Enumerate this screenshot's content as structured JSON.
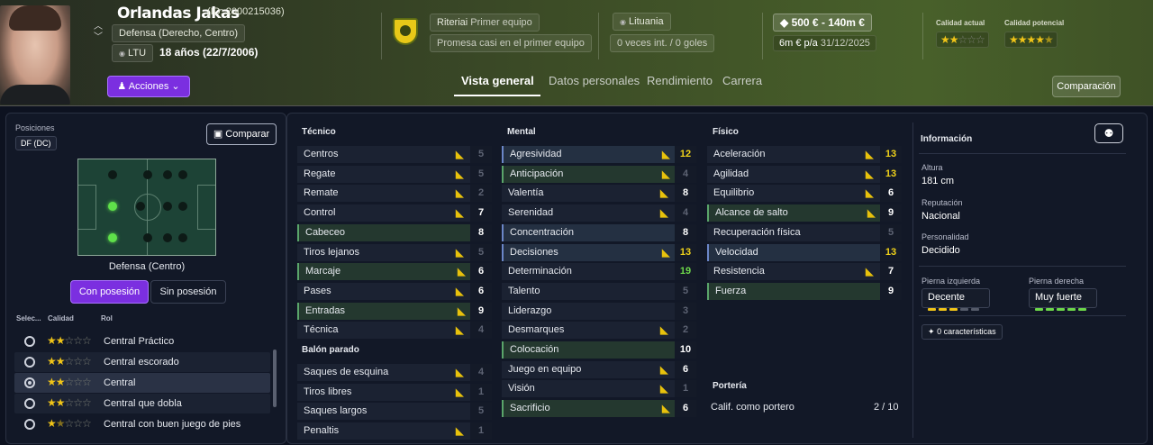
{
  "header": {
    "name": "Orlandas Jakas",
    "id": "(ID: 2000215036)",
    "position": "Defensa (Derecho, Centro)",
    "nationality_code": "LTU",
    "age": "18 años (22/7/2006)",
    "actions_label": "Acciones",
    "club": {
      "name": "Riteriai",
      "squad": "Primer equipo",
      "status": "Promesa casi en el primer equipo"
    },
    "country": {
      "name": "Lituania",
      "caps": "0 veces int. / 0 goles"
    },
    "value": "500 € - 140m €",
    "wage": "6m € p/a",
    "contract_end": "31/12/2025",
    "current_ability_label": "Calidad actual",
    "potential_ability_label": "Calidad potencial",
    "current_stars": 2,
    "potential_stars": 4.5,
    "compare_label": "Comparación",
    "tabs": [
      "Vista general",
      "Datos personales",
      "Rendimiento",
      "Carrera"
    ]
  },
  "left": {
    "positions_label": "Posiciones",
    "position_code": "DF (DC)",
    "compare_button": "Comparar",
    "position_caption": "Defensa (Centro)",
    "toggle_on": "Con posesión",
    "toggle_off": "Sin posesión",
    "col_select": "Selec...",
    "col_quality": "Calidad",
    "col_role": "Rol",
    "roles": [
      {
        "name": "Central Práctico",
        "stars": 2,
        "selected": false
      },
      {
        "name": "Central escorado",
        "stars": 2,
        "selected": false
      },
      {
        "name": "Central",
        "stars": 2,
        "selected": true
      },
      {
        "name": "Central que dobla",
        "stars": 2,
        "selected": false
      },
      {
        "name": "Central con buen juego de pies",
        "stars": 1.5,
        "selected": false
      }
    ]
  },
  "attributes": {
    "tecnico_label": "Técnico",
    "tecnico": [
      {
        "name": "Centros",
        "value": "5",
        "dim": true,
        "icon": true
      },
      {
        "name": "Regate",
        "value": "5",
        "dim": true,
        "icon": true
      },
      {
        "name": "Remate",
        "value": "2",
        "dim": true,
        "icon": true
      },
      {
        "name": "Control",
        "value": "7",
        "icon": true
      },
      {
        "name": "Cabeceo",
        "value": "8",
        "hl": "green"
      },
      {
        "name": "Tiros lejanos",
        "value": "5",
        "dim": true,
        "icon": true
      },
      {
        "name": "Marcaje",
        "value": "6",
        "hl": "green",
        "icon": true
      },
      {
        "name": "Pases",
        "value": "6",
        "icon": true
      },
      {
        "name": "Entradas",
        "value": "9",
        "hl": "green",
        "icon": true
      },
      {
        "name": "Técnica",
        "value": "4",
        "dim": true,
        "icon": true
      }
    ],
    "balon_label": "Balón parado",
    "balon": [
      {
        "name": "Saques de esquina",
        "value": "4",
        "dim": true,
        "icon": true
      },
      {
        "name": "Tiros libres",
        "value": "1",
        "dim": true,
        "icon": true
      },
      {
        "name": "Saques largos",
        "value": "5",
        "dim": true
      },
      {
        "name": "Penaltis",
        "value": "1",
        "dim": true,
        "icon": true
      }
    ],
    "mental_label": "Mental",
    "mental": [
      {
        "name": "Agresividad",
        "value": "12",
        "color": "y",
        "hl": "blue",
        "icon": true
      },
      {
        "name": "Anticipación",
        "value": "4",
        "dim": true,
        "hl": "green",
        "icon": true
      },
      {
        "name": "Valentía",
        "value": "8",
        "icon": true
      },
      {
        "name": "Serenidad",
        "value": "4",
        "dim": true,
        "icon": true
      },
      {
        "name": "Concentración",
        "value": "8",
        "hl": "blue"
      },
      {
        "name": "Decisiones",
        "value": "13",
        "color": "y",
        "hl": "blue",
        "icon": true
      },
      {
        "name": "Determinación",
        "value": "19",
        "color": "g"
      },
      {
        "name": "Talento",
        "value": "5",
        "dim": true
      },
      {
        "name": "Liderazgo",
        "value": "3",
        "dim": true
      },
      {
        "name": "Desmarques",
        "value": "2",
        "dim": true,
        "icon": true
      },
      {
        "name": "Colocación",
        "value": "10",
        "hl": "green"
      },
      {
        "name": "Juego en equipo",
        "value": "6",
        "icon": true
      },
      {
        "name": "Visión",
        "value": "1",
        "dim": true,
        "icon": true
      },
      {
        "name": "Sacrificio",
        "value": "6",
        "hl": "green",
        "icon": true
      }
    ],
    "fisico_label": "Físico",
    "fisico": [
      {
        "name": "Aceleración",
        "value": "13",
        "color": "y",
        "icon": true
      },
      {
        "name": "Agilidad",
        "value": "13",
        "color": "y",
        "icon": true
      },
      {
        "name": "Equilibrio",
        "value": "6",
        "icon": true
      },
      {
        "name": "Alcance de salto",
        "value": "9",
        "hl": "green",
        "icon": true
      },
      {
        "name": "Recuperación física",
        "value": "5",
        "dim": true
      },
      {
        "name": "Velocidad",
        "value": "13",
        "color": "y",
        "hl": "blue"
      },
      {
        "name": "Resistencia",
        "value": "7",
        "icon": true
      },
      {
        "name": "Fuerza",
        "value": "9",
        "hl": "green"
      }
    ],
    "porteria_label": "Portería",
    "gk_label": "Calif. como portero",
    "gk_value": "2 / 10"
  },
  "info": {
    "title": "Información",
    "height_label": "Altura",
    "height": "181 cm",
    "reputation_label": "Reputación",
    "reputation": "Nacional",
    "personality_label": "Personalidad",
    "personality": "Decidido",
    "left_foot_label": "Pierna izquierda",
    "left_foot": "Decente",
    "right_foot_label": "Pierna derecha",
    "right_foot": "Muy fuerte",
    "traits": "0 características"
  },
  "colors": {
    "accent": "#7b2fe0",
    "star": "#f0c418",
    "green": "#6dd84a",
    "yellow": "#f0d21a"
  }
}
